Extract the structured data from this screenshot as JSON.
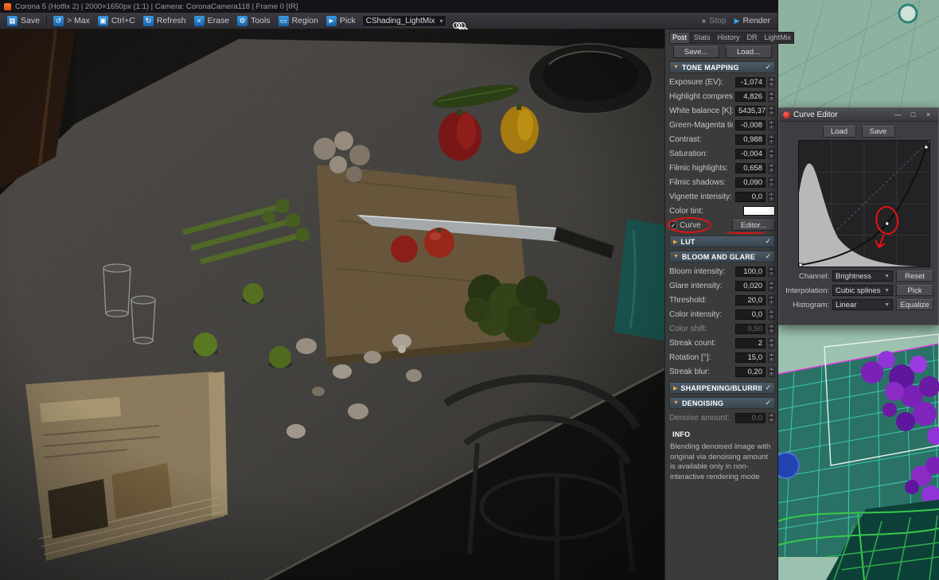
{
  "titlebar": {
    "title": "Corona 5 (Hotfix 2) | 2000×1650px (1:1) | Camera: CoronaCamera118 | Frame 0 [IR]"
  },
  "toolbar": {
    "buttons": [
      {
        "name": "save",
        "label": "Save",
        "glyph": "▦"
      },
      {
        "name": "send-max",
        "label": "> Max",
        "glyph": "↺"
      },
      {
        "name": "copy",
        "label": "Ctrl+C",
        "glyph": "▣"
      },
      {
        "name": "refresh",
        "label": "Refresh",
        "glyph": "↻"
      },
      {
        "name": "erase",
        "label": "Erase",
        "glyph": "×"
      },
      {
        "name": "tools",
        "label": "Tools",
        "glyph": "⚙"
      },
      {
        "name": "region",
        "label": "Region",
        "glyph": "▭"
      },
      {
        "name": "pick",
        "label": "Pick",
        "glyph": "►"
      }
    ],
    "lightmix_select": "CShading_LightMix",
    "stop_label": "Stop",
    "render_label": "Render"
  },
  "panel": {
    "tabs": [
      "Post",
      "Stats",
      "History",
      "DR",
      "LightMix"
    ],
    "save_button": "Save...",
    "load_button": "Load...",
    "tone_mapping": {
      "title": "TONE MAPPING",
      "rows": [
        {
          "label": "Exposure (EV):",
          "value": "-1,074"
        },
        {
          "label": "Highlight compress:",
          "value": "4,826"
        },
        {
          "label": "White balance [K]:",
          "value": "5435,37"
        },
        {
          "label": "Green-Magenta tint:",
          "value": "-0,008"
        },
        {
          "label": "Contrast:",
          "value": "0,988"
        },
        {
          "label": "Saturation:",
          "value": "-0,004"
        },
        {
          "label": "Filmic highlights:",
          "value": "0,658"
        },
        {
          "label": "Filmic shadows:",
          "value": "0,090"
        },
        {
          "label": "Vignette intensity:",
          "value": "0,0"
        }
      ],
      "color_tint_label": "Color tint:",
      "curve_label": "Curve",
      "editor_button": "Editor..."
    },
    "lut": {
      "title": "LUT"
    },
    "bloom_glare": {
      "title": "BLOOM AND GLARE",
      "rows": [
        {
          "label": "Bloom intensity:",
          "value": "100,0"
        },
        {
          "label": "Glare intensity:",
          "value": "0,020"
        },
        {
          "label": "Threshold:",
          "value": "20,0"
        },
        {
          "label": "Color intensity:",
          "value": "0,0"
        },
        {
          "label": "Color shift:",
          "value": "0,50",
          "disabled": true
        },
        {
          "label": "Streak count:",
          "value": "2"
        },
        {
          "label": "Rotation [°]:",
          "value": "15,0"
        },
        {
          "label": "Streak blur:",
          "value": "0,20"
        }
      ]
    },
    "sharpening": {
      "title": "SHARPENING/BLURRING"
    },
    "denoising": {
      "title": "DENOISING",
      "rows": [
        {
          "label": "Denoise amount:",
          "value": "0,0",
          "disabled": true
        }
      ]
    },
    "info": {
      "title": "INFO",
      "text": "Blending denoised image with original via denoising amount is available only in non-interactive rendering mode"
    }
  },
  "curve_editor": {
    "title": "Curve Editor",
    "load_button": "Load",
    "save_button": "Save",
    "channel_label": "Channel:",
    "channel_value": "Brightness",
    "reset_button": "Reset",
    "interpolation_label": "Interpolation:",
    "interpolation_value": "Cubic splines",
    "pick_button": "Pick",
    "histogram_label": "Histogram:",
    "histogram_value": "Linear",
    "equalize_button": "Equalize"
  },
  "colors": {
    "accent_blue": "#2f8fd8",
    "annotation_red": "#dd1414",
    "header_blue": "#45525e",
    "viewport_sage": "#8fb2a0",
    "viewport_teal": "#2a7265"
  },
  "glyphs": {
    "check": "✓",
    "spin_up": "▴",
    "spin_down": "▾",
    "dd": "▼",
    "open": "▼",
    "closed": "▶",
    "minimize": "—",
    "maximize": "□",
    "close": "×",
    "stop": "■",
    "play": "▶"
  }
}
